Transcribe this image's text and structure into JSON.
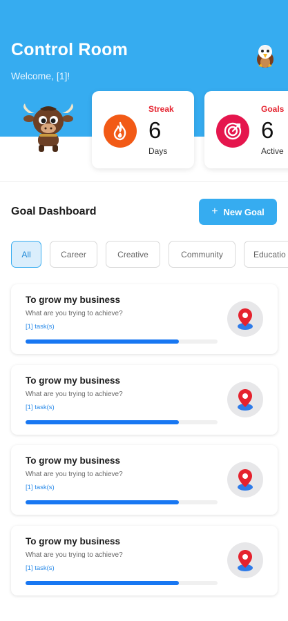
{
  "header": {
    "title": "Control Room",
    "welcome": "Welcome, [1]!",
    "bg_color": "#36acf0"
  },
  "stats": {
    "streak": {
      "label": "Streak",
      "value": "6",
      "sub": "Days",
      "icon": "flame-icon",
      "color": "#f25a16"
    },
    "goals": {
      "label": "Goals",
      "value": "6",
      "sub": "Active",
      "icon": "target-icon",
      "color": "#e5164d"
    }
  },
  "dashboard": {
    "title": "Goal Dashboard",
    "new_goal_label": "New Goal"
  },
  "filters": [
    {
      "label": "All",
      "active": true
    },
    {
      "label": "Career",
      "active": false
    },
    {
      "label": "Creative",
      "active": false
    },
    {
      "label": "Community",
      "active": false
    },
    {
      "label": "Educatio",
      "active": false
    }
  ],
  "goals": [
    {
      "title": "To grow my business",
      "description": "What are you trying to achieve?",
      "tasks": "[1] task(s)",
      "progress": 0.8,
      "icon": "map-pin-icon"
    },
    {
      "title": "To grow my business",
      "description": "What are you trying to achieve?",
      "tasks": "[1] task(s)",
      "progress": 0.8,
      "icon": "map-pin-icon"
    },
    {
      "title": "To grow my business",
      "description": "What are you trying to achieve?",
      "tasks": "[1] task(s)",
      "progress": 0.8,
      "icon": "map-pin-icon"
    },
    {
      "title": "To grow my business",
      "description": "What are you trying to achieve?",
      "tasks": "[1] task(s)",
      "progress": 0.8,
      "icon": "map-pin-icon"
    }
  ],
  "colors": {
    "accent": "#36acf0",
    "progress": "#1877f2",
    "pin": "#e5222e"
  }
}
